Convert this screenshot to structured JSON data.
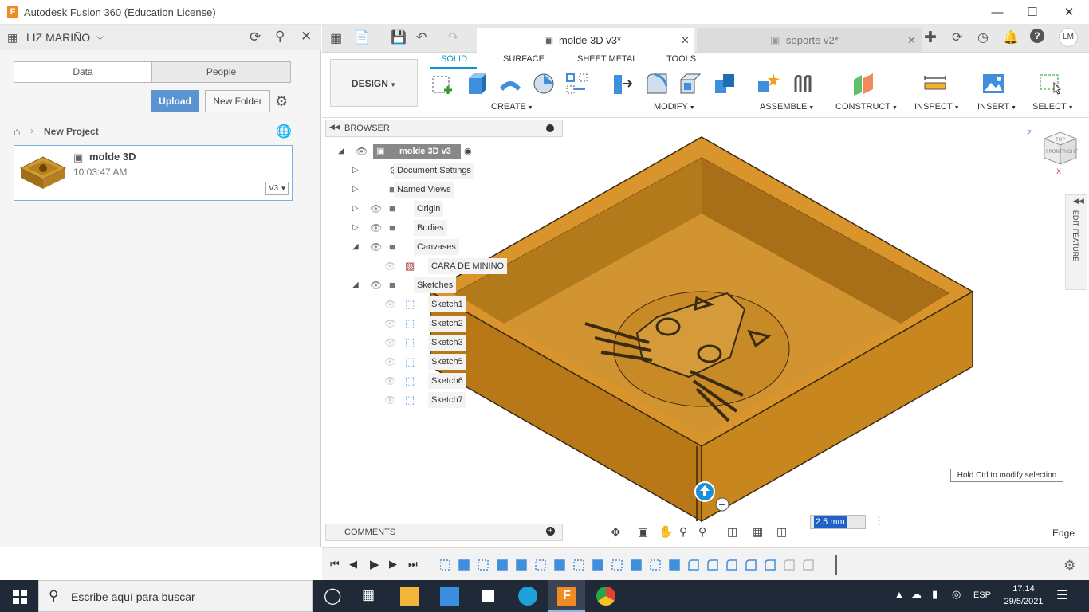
{
  "window": {
    "title": "Autodesk Fusion 360 (Education License)",
    "logo_letter": "F"
  },
  "data_panel": {
    "user": "LIZ MARIÑO",
    "tabs": [
      "Data",
      "People"
    ],
    "upload_label": "Upload",
    "new_folder_label": "New Folder",
    "breadcrumb": "New Project",
    "file": {
      "name": "molde 3D",
      "time": "10:03:47 AM",
      "version": "V3"
    }
  },
  "doc_tabs": [
    {
      "label": "molde 3D v3*",
      "active": true
    },
    {
      "label": "soporte v2*",
      "active": false
    }
  ],
  "user_initials": "LM",
  "toolbar": {
    "workspace": "DESIGN",
    "tabs": [
      "SOLID",
      "SURFACE",
      "SHEET METAL",
      "TOOLS"
    ],
    "groups": [
      "CREATE",
      "MODIFY",
      "ASSEMBLE",
      "CONSTRUCT",
      "INSPECT",
      "INSERT",
      "SELECT"
    ]
  },
  "browser": {
    "title": "BROWSER",
    "root": "molde 3D v3",
    "items": [
      {
        "label": "Document Settings",
        "kind": "gear"
      },
      {
        "label": "Named Views",
        "kind": "folder"
      },
      {
        "label": "Origin",
        "kind": "folder"
      },
      {
        "label": "Bodies",
        "kind": "folder"
      },
      {
        "label": "Canvases",
        "kind": "folder"
      },
      {
        "label": "CARA DE MININO",
        "kind": "canvas"
      },
      {
        "label": "Sketches",
        "kind": "folder"
      },
      {
        "label": "Sketch1",
        "kind": "sketch"
      },
      {
        "label": "Sketch2",
        "kind": "sketch"
      },
      {
        "label": "Sketch3",
        "kind": "sketch"
      },
      {
        "label": "Sketch5",
        "kind": "sketch"
      },
      {
        "label": "Sketch6",
        "kind": "sketch"
      },
      {
        "label": "Sketch7",
        "kind": "sketch"
      }
    ]
  },
  "comments_label": "COMMENTS",
  "viewcube": {
    "top": "TOP",
    "front": "FRONT",
    "right": "RIGHT",
    "z": "Z",
    "x": "X"
  },
  "edit_feature_label": "EDIT FEATURE",
  "tooltip": "Hold Ctrl to modify selection",
  "dimension_input": "2.5 mm",
  "selection_type": "Edge",
  "colors": {
    "accent": "#0696d7",
    "model": "#c8901e",
    "upload": "#5b94d1"
  },
  "taskbar": {
    "search_placeholder": "Escribe aquí para buscar",
    "language": "ESP",
    "time": "17:14",
    "date": "29/5/2021"
  }
}
